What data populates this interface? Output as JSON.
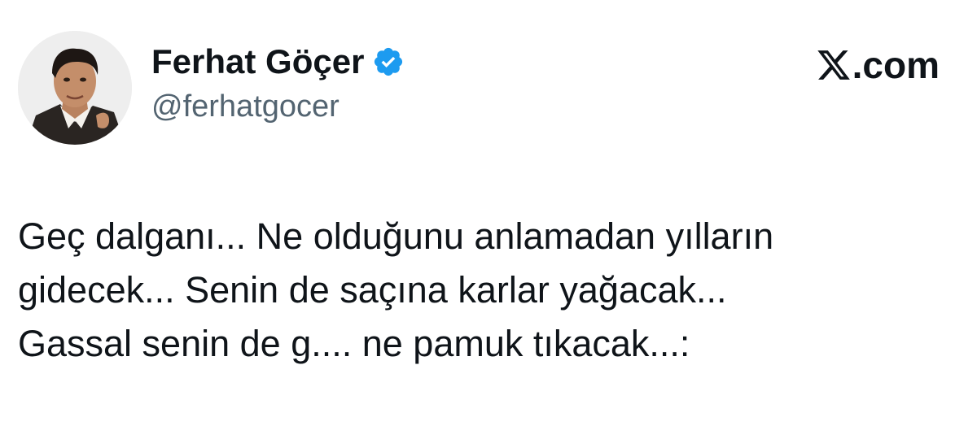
{
  "author": {
    "display_name": "Ferhat Göçer",
    "handle": "@ferhatgocer",
    "avatar_icon": "profile-photo",
    "verified_icon": "verified-badge-icon",
    "verified_color": "#1d9bf0"
  },
  "brand": {
    "logo_icon": "x-logo-icon",
    "text": ".com"
  },
  "tweet": {
    "lines": [
      "Geç dalganı... Ne olduğunu anlamadan yılların",
      "gidecek... Senin de saçına karlar yağacak...",
      "Gassal senin de g.... ne pamuk tıkacak...:"
    ]
  },
  "colors": {
    "text_primary": "#0f1419",
    "text_secondary": "#536471",
    "background": "#ffffff"
  }
}
